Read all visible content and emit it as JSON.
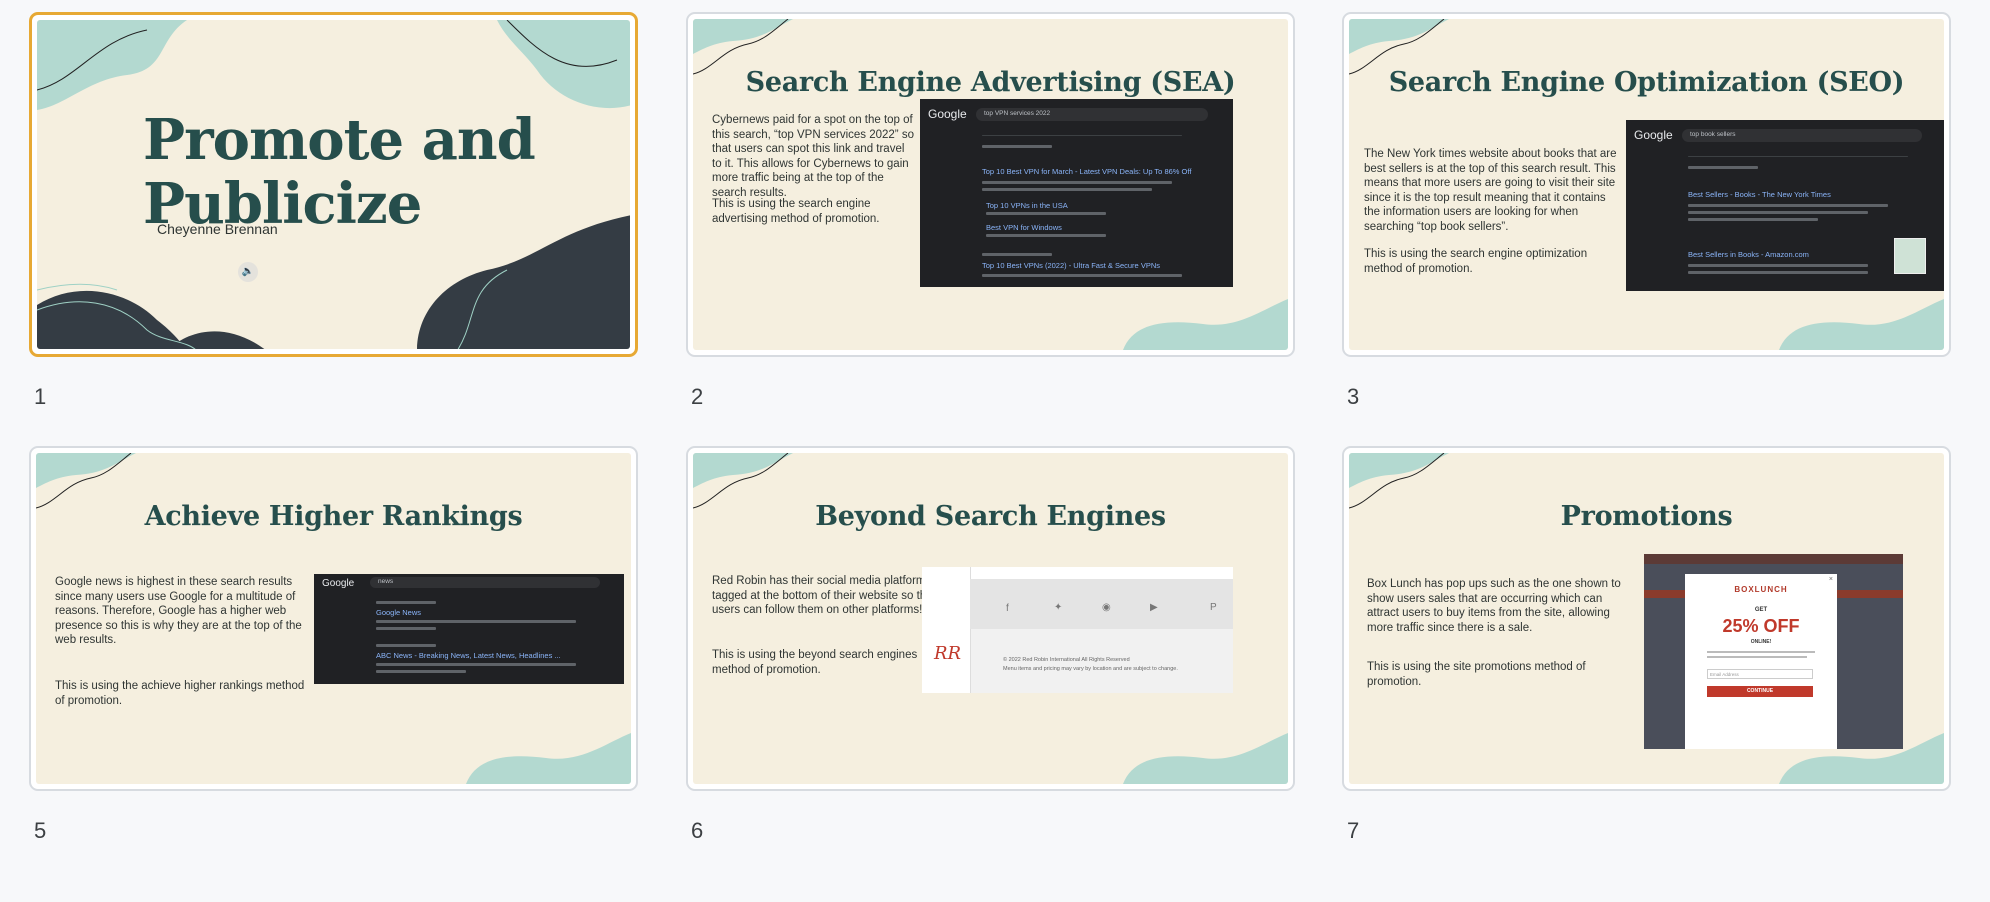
{
  "slides": [
    {
      "number": "1",
      "title_line1": "Promote and",
      "title_line2": "Publicize",
      "author": "Cheyenne Brennan"
    },
    {
      "number": "2",
      "title": "Search Engine Advertising (SEA)",
      "para1": "Cybernews paid for a spot on the top of this search, “top VPN services 2022” so that users can spot this link and travel to it. This allows for Cybernews to gain more traffic being at the top of the search results.",
      "para2": "This is using the search engine advertising method of promotion.",
      "shot": {
        "logo": "Google",
        "query": "top VPN services 2022",
        "links": [
          "Top 10 Best VPN for March - Latest VPN Deals: Up To 86% Off",
          "Top 10 VPNs in the USA",
          "Best VPN for Windows",
          "Top 10 Best VPNs (2022) - Ultra Fast & Secure VPNs"
        ]
      }
    },
    {
      "number": "3",
      "title": "Search Engine Optimization (SEO)",
      "para1": "The New York times website about books that are best sellers is at the top of this search result. This means that more users are going to visit their site since it is the top result meaning that it contains the information users are looking for when searching “top book sellers”.",
      "para2": "This is using the search engine optimization method of promotion.",
      "shot": {
        "logo": "Google",
        "query": "top book sellers",
        "links": [
          "Best Sellers - Books - The New York Times",
          "Best Sellers in Books - Amazon.com"
        ]
      }
    },
    {
      "number": "5",
      "title": "Achieve Higher Rankings",
      "para1": "Google news is highest in these search results since many users use Google for a multitude of reasons. Therefore, Google has a higher web presence so this is why they are at the top of the web results.",
      "para2": "This is using the achieve higher rankings  method of promotion.",
      "shot": {
        "logo": "Google",
        "query": "news",
        "links": [
          "Google News",
          "ABC News - Breaking News, Latest News, Headlines ..."
        ]
      }
    },
    {
      "number": "6",
      "title": "Beyond Search Engines",
      "para1": "Red Robin has their social media platforms tagged at the bottom of their website so that users can follow them on other platforms!",
      "para2": "This is using the beyond search engines method of promotion.",
      "shot": {
        "copyright": "© 2022 Red Robin International All Rights Reserved",
        "note": "Menu items and pricing may vary by location and are subject to change."
      }
    },
    {
      "number": "7",
      "title": "Promotions",
      "para1": "Box Lunch has pop ups such as the one shown to show users sales that are occurring which can attract users to buy items from the site, allowing more traffic since there is a sale.",
      "para2": "This is using the site promotions method of promotion.",
      "shot": {
        "brand": "BOXLUNCH",
        "get": "GET",
        "offer": "25% OFF",
        "online": "ONLINE!",
        "email_placeholder": "Email Address",
        "button": "CONTINUE"
      }
    }
  ],
  "colors": {
    "accent": "#e7a934",
    "title": "#264e4c",
    "mint": "#b3d9d0",
    "dark": "#343c44",
    "slide_bg": "#f5efdf"
  }
}
